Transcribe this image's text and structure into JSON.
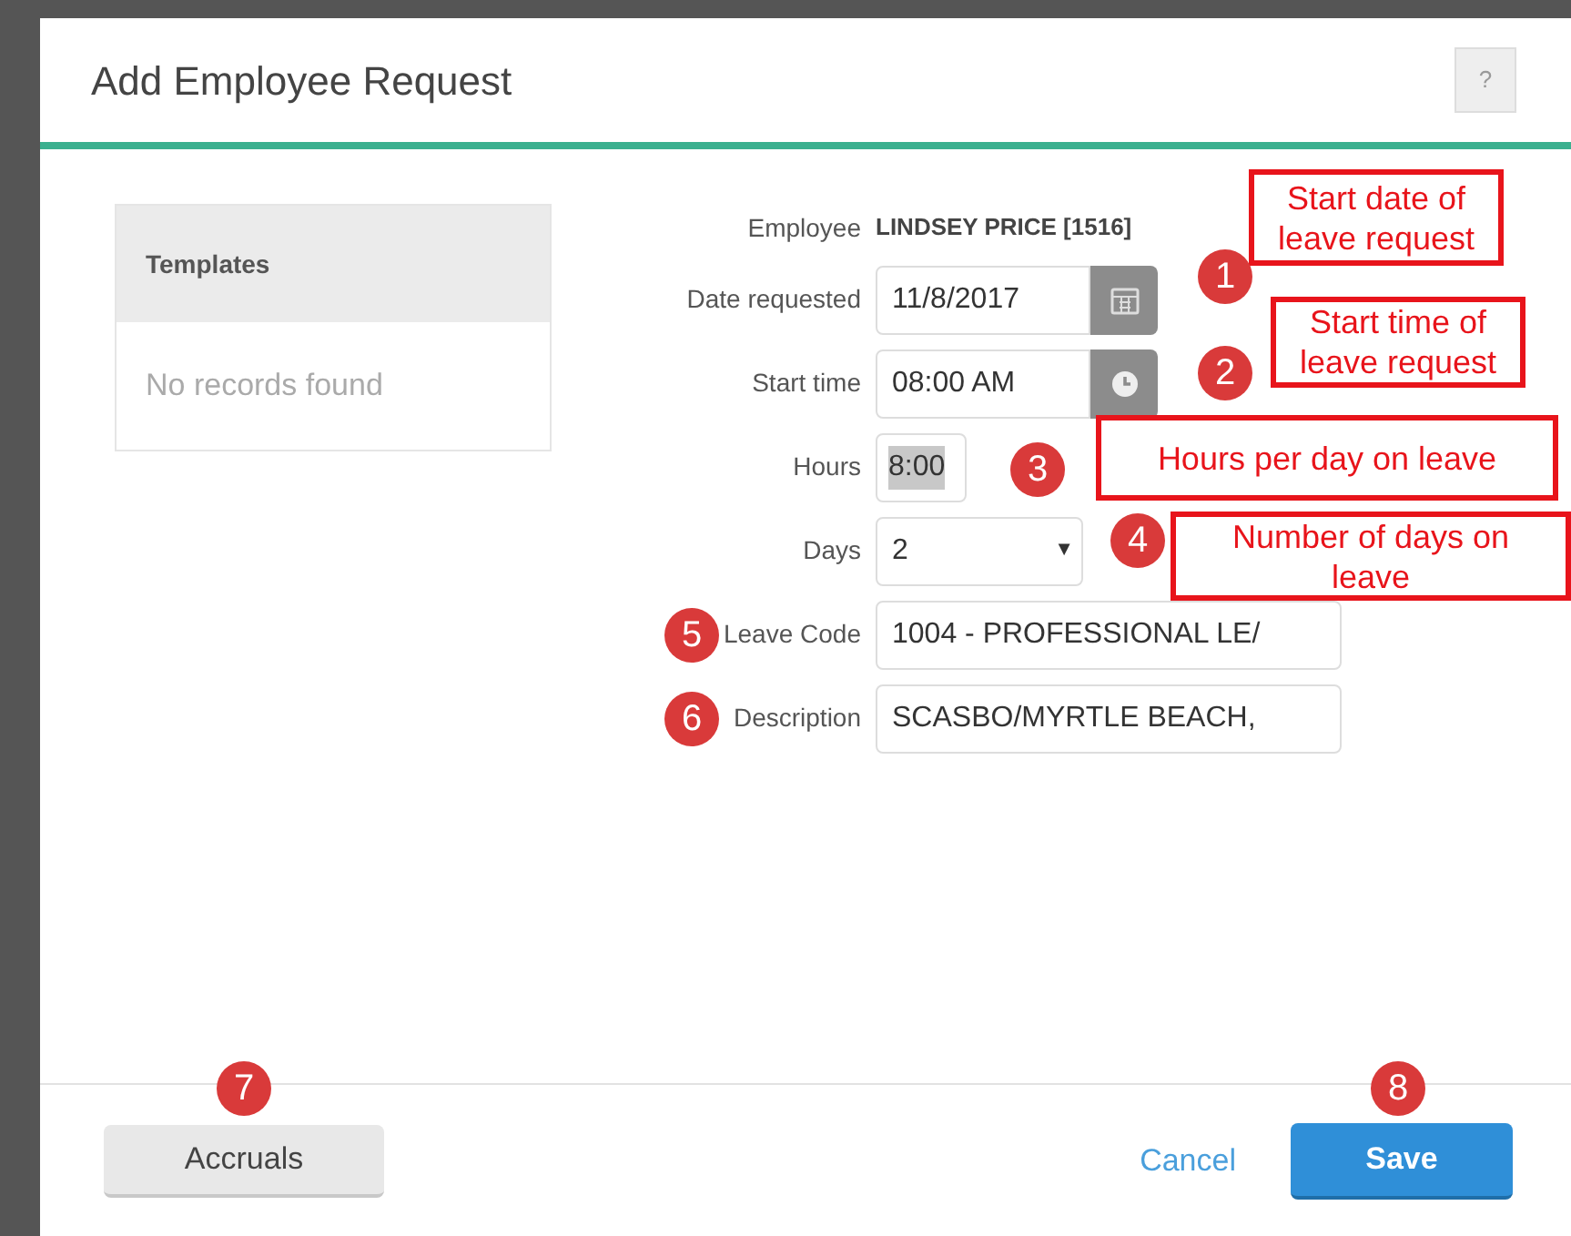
{
  "dialog": {
    "title": "Add Employee Request",
    "help_button": "?"
  },
  "templates": {
    "title": "Templates",
    "empty_text": "No records found"
  },
  "fields": [
    {
      "kind": "display",
      "label": "Employee",
      "value": "LINDSEY PRICE [1516]"
    },
    {
      "kind": "date",
      "label": "Date requested",
      "value": "11/8/2017"
    },
    {
      "kind": "time",
      "label": "Start time",
      "value": "08:00 AM"
    },
    {
      "kind": "hours",
      "label": "Hours",
      "value": "8:00",
      "text_selected": true
    },
    {
      "kind": "select",
      "label": "Days",
      "value": "2",
      "arrow": "▼"
    },
    {
      "kind": "textarea",
      "label": "Leave Code",
      "value": "1004 - PROFESSIONAL LE/"
    },
    {
      "kind": "text",
      "label": "Description",
      "value": "SCASBO/MYRTLE BEACH,"
    }
  ],
  "footer": {
    "accruals_button": "Accruals",
    "cancel_link": "Cancel",
    "save_button": "Save"
  },
  "annotations": [
    {
      "number": "1",
      "note": "Start date of leave request"
    },
    {
      "number": "2",
      "note": "Start time of leave request"
    },
    {
      "number": "3",
      "note": "Hours per day on leave"
    },
    {
      "number": "4",
      "note": "Number of days on leave"
    },
    {
      "number": "5"
    },
    {
      "number": "6"
    },
    {
      "number": "7"
    },
    {
      "number": "8"
    }
  ]
}
